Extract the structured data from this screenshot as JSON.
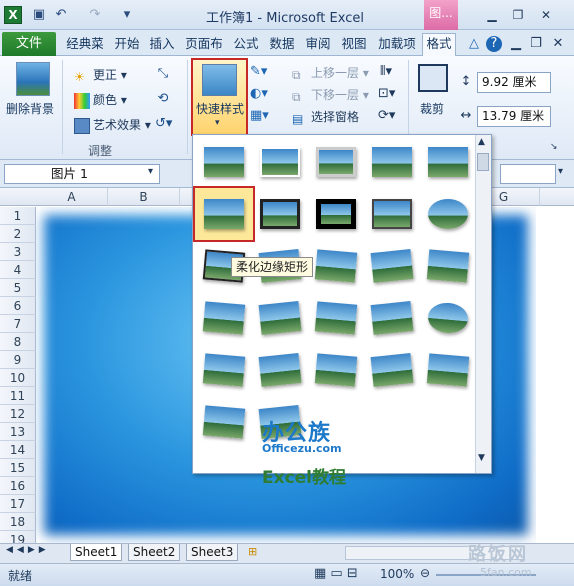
{
  "window": {
    "title": "工作簿1 - Microsoft Excel",
    "context_tab": "图...",
    "app_icon": "X"
  },
  "tabs": [
    "文件",
    "经典菜",
    "开始",
    "插入",
    "页面布",
    "公式",
    "数据",
    "审阅",
    "视图",
    "加载项",
    "格式"
  ],
  "ribbon": {
    "remove_bg": "删除背景",
    "correct": "更正",
    "color": "颜色",
    "artistic": "艺术效果",
    "group_adjust": "调整",
    "quick_styles": "快速样式",
    "bring_forward": "上移一层",
    "send_backward": "下移一层",
    "selection_pane": "选择窗格",
    "crop": "裁剪",
    "height": "9.92 厘米",
    "width": "13.79 厘米"
  },
  "formula_bar": {
    "name_box": "图片 1"
  },
  "grid": {
    "columns": [
      "A",
      "B",
      "G"
    ],
    "rows": [
      "1",
      "2",
      "3",
      "4",
      "5",
      "6",
      "7",
      "8",
      "9",
      "10",
      "11",
      "12",
      "13",
      "14",
      "15",
      "16",
      "17",
      "18",
      "19"
    ]
  },
  "gallery": {
    "tooltip": "柔化边缘矩形"
  },
  "watermark": {
    "brand": "办公族",
    "url": "Officezu.com",
    "tagline": "Excel教程",
    "corner_logo": "路饭网",
    "corner_url": "5fan.com"
  },
  "sheets": [
    "Sheet1",
    "Sheet2",
    "Sheet3"
  ],
  "status": {
    "ready": "就绪",
    "zoom": "100%"
  }
}
